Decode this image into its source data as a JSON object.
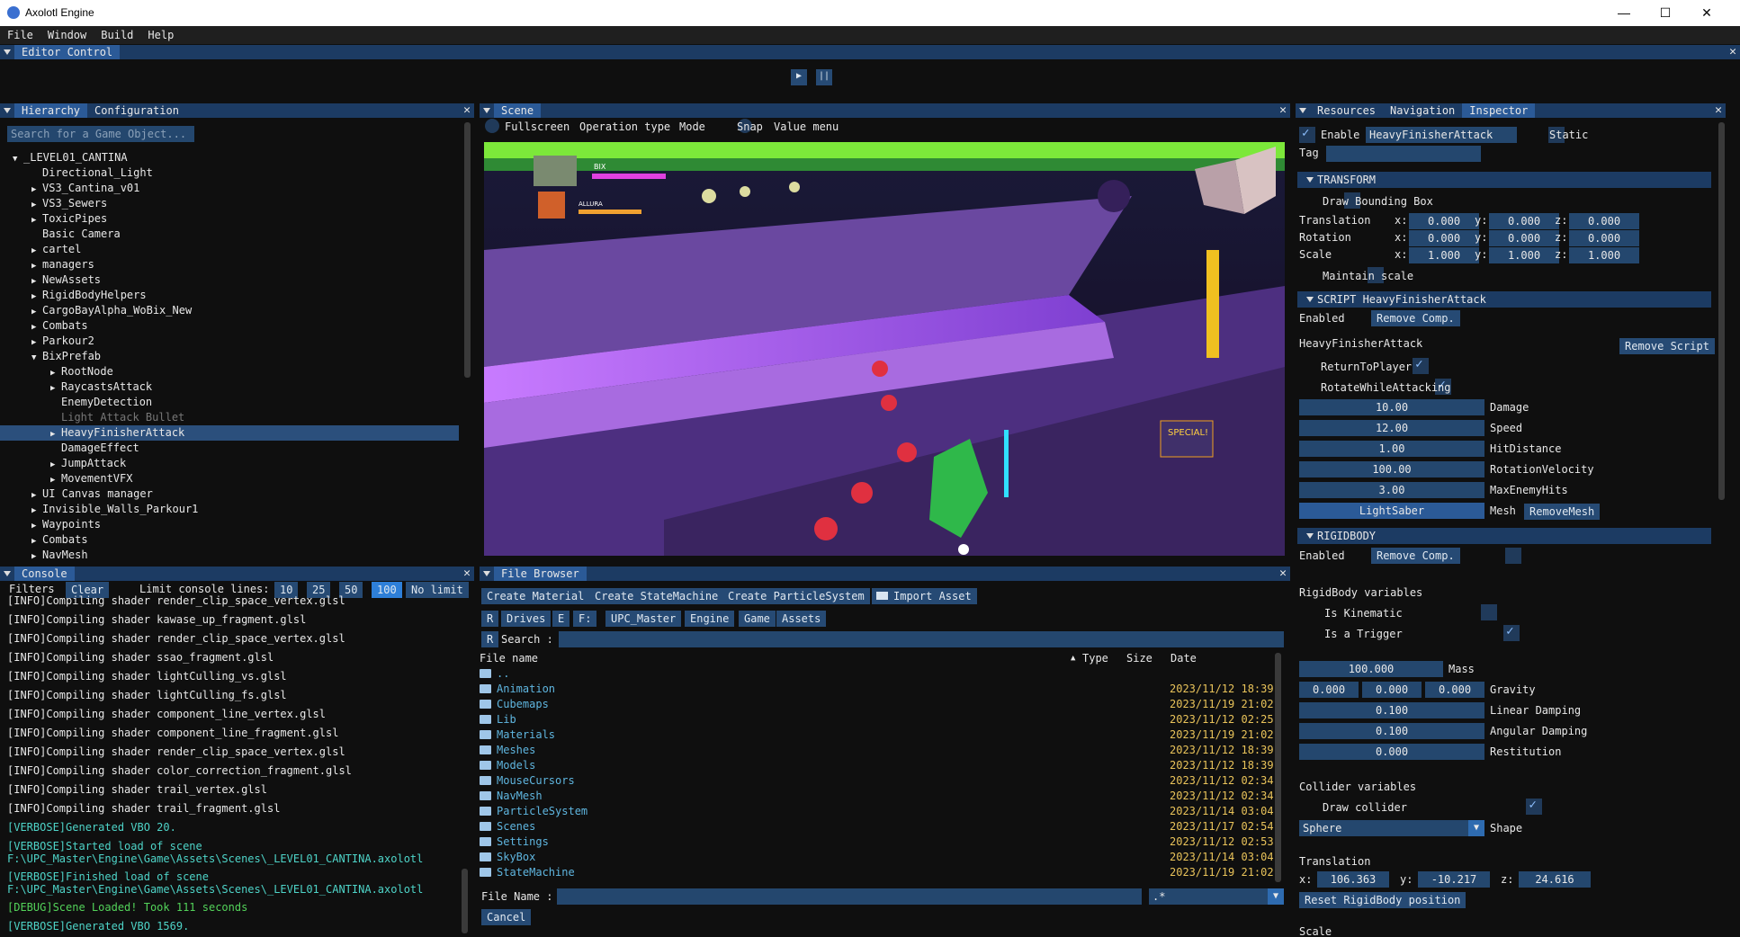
{
  "app": {
    "title": "Axolotl Engine",
    "min": "—",
    "max": "☐",
    "close": "✕"
  },
  "menu": [
    "File",
    "Window",
    "Build",
    "Help"
  ],
  "editor": {
    "tab": "Editor Control",
    "play": "▶",
    "pause": "||"
  },
  "hierarchy": {
    "tabs": [
      "Hierarchy",
      "Configuration"
    ],
    "search_placeholder": "Search for a Game Object...",
    "items": [
      {
        "label": "_LEVEL01_CANTINA",
        "depth": 0,
        "arrow": "down"
      },
      {
        "label": "Directional_Light",
        "depth": 1,
        "arrow": ""
      },
      {
        "label": "VS3_Cantina_v01",
        "depth": 1,
        "arrow": "right"
      },
      {
        "label": "VS3_Sewers",
        "depth": 1,
        "arrow": "right"
      },
      {
        "label": "ToxicPipes",
        "depth": 1,
        "arrow": "right"
      },
      {
        "label": "Basic Camera",
        "depth": 1,
        "arrow": ""
      },
      {
        "label": "cartel",
        "depth": 1,
        "arrow": "right"
      },
      {
        "label": "managers",
        "depth": 1,
        "arrow": "right"
      },
      {
        "label": "NewAssets",
        "depth": 1,
        "arrow": "right"
      },
      {
        "label": "RigidBodyHelpers",
        "depth": 1,
        "arrow": "right"
      },
      {
        "label": "CargoBayAlpha_WoBix_New",
        "depth": 1,
        "arrow": "right"
      },
      {
        "label": "Combats",
        "depth": 1,
        "arrow": "right"
      },
      {
        "label": "Parkour2",
        "depth": 1,
        "arrow": "right"
      },
      {
        "label": "BixPrefab",
        "depth": 1,
        "arrow": "down"
      },
      {
        "label": "RootNode",
        "depth": 2,
        "arrow": "right"
      },
      {
        "label": "RaycastsAttack",
        "depth": 2,
        "arrow": "right"
      },
      {
        "label": "EnemyDetection",
        "depth": 2,
        "arrow": ""
      },
      {
        "label": "Light Attack Bullet",
        "depth": 2,
        "arrow": "",
        "dim": true
      },
      {
        "label": "HeavyFinisherAttack",
        "depth": 2,
        "arrow": "right",
        "selected": true
      },
      {
        "label": "DamageEffect",
        "depth": 2,
        "arrow": ""
      },
      {
        "label": "JumpAttack",
        "depth": 2,
        "arrow": "right"
      },
      {
        "label": "MovementVFX",
        "depth": 2,
        "arrow": "right"
      },
      {
        "label": "UI Canvas manager",
        "depth": 1,
        "arrow": "right"
      },
      {
        "label": "Invisible_Walls_Parkour1",
        "depth": 1,
        "arrow": "right"
      },
      {
        "label": "Waypoints",
        "depth": 1,
        "arrow": "right"
      },
      {
        "label": "Combats",
        "depth": 1,
        "arrow": "right"
      },
      {
        "label": "NavMesh",
        "depth": 1,
        "arrow": "right"
      }
    ]
  },
  "scene": {
    "tab": "Scene",
    "toolbar": [
      "Fullscreen",
      "Operation type",
      "Mode",
      "Snap",
      "Value menu"
    ],
    "hud": {
      "p1": "BIX",
      "p2": "ALLURA",
      "special": "SPECIAL!"
    }
  },
  "console": {
    "tab": "Console",
    "filters": "Filters",
    "clear": "Clear",
    "limit_label": "Limit console lines:",
    "limits": [
      "10",
      "25",
      "50",
      "100",
      "No limit"
    ],
    "limit_active": "100",
    "lines": [
      {
        "t": "[INFO]Compiling shader render_clip_space_vertex.glsl",
        "c": "info"
      },
      {
        "t": "[INFO]Compiling shader kawase_up_fragment.glsl",
        "c": "info"
      },
      {
        "t": "[INFO]Compiling shader render_clip_space_vertex.glsl",
        "c": "info"
      },
      {
        "t": "[INFO]Compiling shader ssao_fragment.glsl",
        "c": "info"
      },
      {
        "t": "[INFO]Compiling shader lightCulling_vs.glsl",
        "c": "info"
      },
      {
        "t": "[INFO]Compiling shader lightCulling_fs.glsl",
        "c": "info"
      },
      {
        "t": "[INFO]Compiling shader component_line_vertex.glsl",
        "c": "info"
      },
      {
        "t": "[INFO]Compiling shader component_line_fragment.glsl",
        "c": "info"
      },
      {
        "t": "[INFO]Compiling shader render_clip_space_vertex.glsl",
        "c": "info"
      },
      {
        "t": "[INFO]Compiling shader color_correction_fragment.glsl",
        "c": "info"
      },
      {
        "t": "[INFO]Compiling shader trail_vertex.glsl",
        "c": "info"
      },
      {
        "t": "[INFO]Compiling shader trail_fragment.glsl",
        "c": "info"
      },
      {
        "t": "[VERBOSE]Generated VBO 20.",
        "c": "verbose"
      },
      {
        "t": "[VERBOSE]Started load of scene",
        "t2": "F:\\UPC_Master\\Engine\\Game\\Assets\\Scenes\\_LEVEL01_CANTINA.axolotl",
        "c": "verbose"
      },
      {
        "t": "[VERBOSE]Finished load of scene",
        "t2": "F:\\UPC_Master\\Engine\\Game\\Assets\\Scenes\\_LEVEL01_CANTINA.axolotl",
        "c": "verbose"
      },
      {
        "t": "[DEBUG]Scene Loaded! Took 111 seconds",
        "c": "debug"
      },
      {
        "t": "[VERBOSE]Generated VBO 1569.",
        "c": "verbose"
      }
    ]
  },
  "filebrowser": {
    "tab": "File Browser",
    "buttons": [
      "Create Material",
      "Create StateMachine",
      "Create ParticleSystem",
      "Import Asset"
    ],
    "nav": {
      "r": "R",
      "drives": "Drives",
      "e": "E",
      "f": "F:",
      "crumbs": [
        "UPC_Master",
        "Engine",
        "Game",
        "Assets"
      ]
    },
    "search_label": "Search :",
    "cols": {
      "name": "File name",
      "type": "Type",
      "size": "Size",
      "date": "Date",
      "sort": "▲"
    },
    "rows": [
      {
        "n": "..",
        "d": ""
      },
      {
        "n": "Animation",
        "d": "2023/11/12 18:39"
      },
      {
        "n": "Cubemaps",
        "d": "2023/11/19 21:02"
      },
      {
        "n": "Lib",
        "d": "2023/11/12 02:25"
      },
      {
        "n": "Materials",
        "d": "2023/11/19 21:02"
      },
      {
        "n": "Meshes",
        "d": "2023/11/12 18:39"
      },
      {
        "n": "Models",
        "d": "2023/11/12 18:39"
      },
      {
        "n": "MouseCursors",
        "d": "2023/11/12 02:34"
      },
      {
        "n": "NavMesh",
        "d": "2023/11/12 02:34"
      },
      {
        "n": "ParticleSystem",
        "d": "2023/11/14 03:04"
      },
      {
        "n": "Scenes",
        "d": "2023/11/17 02:54"
      },
      {
        "n": "Settings",
        "d": "2023/11/12 02:53"
      },
      {
        "n": "SkyBox",
        "d": "2023/11/14 03:04"
      },
      {
        "n": "StateMachine",
        "d": "2023/11/19 21:02"
      }
    ],
    "filename_label": "File Name :",
    "filter": ".*",
    "cancel": "Cancel"
  },
  "inspector": {
    "tabs": [
      "Resources",
      "Navigation",
      "Inspector"
    ],
    "enable": "Enable",
    "name": "HeavyFinisherAttack",
    "static": "Static",
    "tag": "Tag",
    "transform": {
      "header": "TRANSFORM",
      "bbox": "Draw Bounding Box",
      "rows": [
        {
          "l": "Translation",
          "x": "0.000",
          "y": "0.000",
          "z": "0.000"
        },
        {
          "l": "Rotation",
          "x": "0.000",
          "y": "0.000",
          "z": "0.000"
        },
        {
          "l": "Scale",
          "x": "1.000",
          "y": "1.000",
          "z": "1.000"
        }
      ],
      "maintain": "Maintain scale"
    },
    "script": {
      "header": "SCRIPT HeavyFinisherAttack",
      "enabled": "Enabled",
      "remove": "Remove Comp.",
      "name": "HeavyFinisherAttack",
      "remove_script": "Remove Script",
      "checks": [
        "ReturnToPlayer",
        "RotateWhileAttacking"
      ],
      "fields": [
        {
          "v": "10.00",
          "l": "Damage"
        },
        {
          "v": "12.00",
          "l": "Speed"
        },
        {
          "v": "1.00",
          "l": "HitDistance"
        },
        {
          "v": "100.00",
          "l": "RotationVelocity"
        },
        {
          "v": "3.00",
          "l": "MaxEnemyHits"
        },
        {
          "v": "LightSaber",
          "l": "Mesh"
        }
      ],
      "remove_mesh": "RemoveMesh"
    },
    "rigidbody": {
      "header": "RIGIDBODY",
      "enabled": "Enabled",
      "remove": "Remove Comp.",
      "vars": "RigidBody variables",
      "kinematic": "Is Kinematic",
      "trigger": "Is a Trigger",
      "mass": {
        "v": "100.000",
        "l": "Mass"
      },
      "gravity": {
        "x": "0.000",
        "y": "0.000",
        "z": "0.000",
        "l": "Gravity"
      },
      "fields": [
        {
          "v": "0.100",
          "l": "Linear Damping"
        },
        {
          "v": "0.100",
          "l": "Angular Damping"
        },
        {
          "v": "0.000",
          "l": "Restitution"
        }
      ],
      "collider_vars": "Collider variables",
      "draw_collider": "Draw collider",
      "shape_value": "Sphere",
      "shape": "Shape",
      "translation": "Translation",
      "tx": "106.363",
      "ty": "-10.217",
      "tz": "24.616",
      "reset": "Reset RigidBody position",
      "scale": "Scale"
    }
  },
  "colors": {
    "accent": "#2b5a97",
    "header": "#1c3b63",
    "field": "#24476e",
    "verbose": "#4ed4c8",
    "debug": "#53d35a",
    "date": "#e9c35a",
    "folder": "#5fb6e0"
  }
}
